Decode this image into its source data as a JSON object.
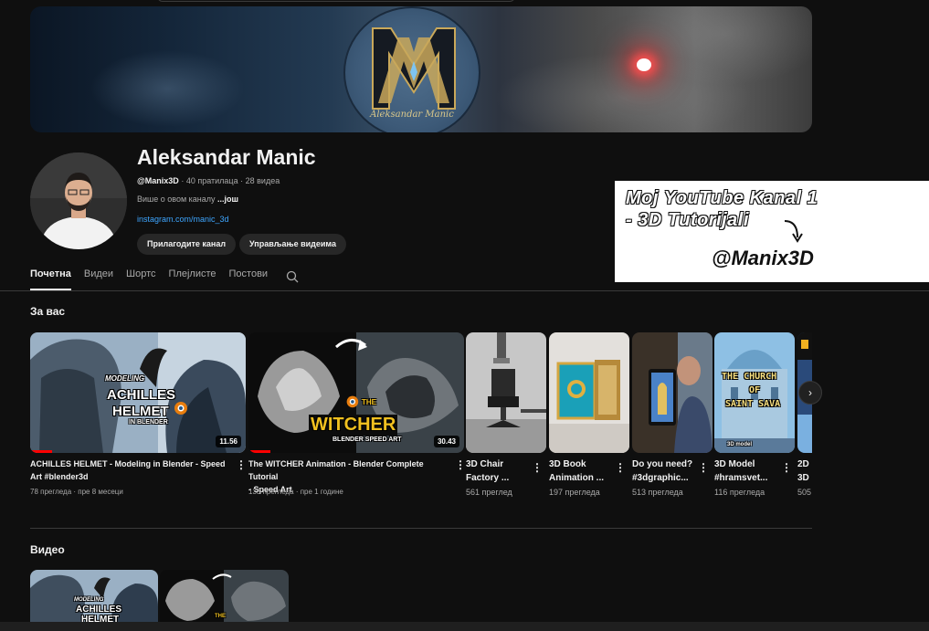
{
  "banner": {
    "logo_text": "Aleksandar Manic"
  },
  "channel": {
    "name": "Aleksandar Manic",
    "handle": "@Manix3D",
    "subscribers": "40 пратилаца",
    "videos_count": "28 видеа",
    "separator": "·",
    "about": "Више о овом каналу",
    "about_more": "...још",
    "link": "instagram.com/manic_3d",
    "customize_label": "Прилагодите канал",
    "manage_label": "Управљање видеима"
  },
  "overlay": {
    "line1": "Moj YouTube Kanal 1",
    "line2": "- 3D Tutorijali",
    "handle": "@Manix3D"
  },
  "tabs": [
    {
      "label": "Почетна",
      "active": true
    },
    {
      "label": "Видеи"
    },
    {
      "label": "Шортс"
    },
    {
      "label": "Плејлисте"
    },
    {
      "label": "Постови"
    }
  ],
  "sections": {
    "for_you": "За вас",
    "videos": "Видео"
  },
  "for_you": [
    {
      "title_l1": "ACHILLES HELMET - Modeling in Blender - Speed",
      "title_l2": "Art #blender3d",
      "views": "78 прегледа",
      "age": "пре 8 месеци",
      "duration": "11.56",
      "progress": 0.1
    },
    {
      "title_l1": "The WITCHER Animation - Blender Complete Tutorial",
      "title_l2": "- Speed Art",
      "views": "133 прегледа",
      "age": "пре 1 године",
      "duration": "30.43",
      "progress": 0.1
    },
    {
      "title_l1": "3D Chair",
      "title_l2": "Factory ...",
      "views": "561 преглед"
    },
    {
      "title_l1": "3D Book",
      "title_l2": "Animation ...",
      "views": "197 прегледа"
    },
    {
      "title_l1": "Do you need?",
      "title_l2": "#3dgraphic...",
      "views": "513 прегледа"
    },
    {
      "title_l1": "3D Model",
      "title_l2": "#hramsvet...",
      "views": "116 прегледа"
    },
    {
      "title_l1": "2D",
      "title_l2": "3D",
      "views": "505"
    }
  ],
  "thumb_text": {
    "achilles_modeling": "MODELING",
    "achilles_title1": "ACHILLES",
    "achilles_title2": "HELMET",
    "achilles_in": "IN BLENDER",
    "witcher_the": "THE",
    "witcher_title": "WITCHER",
    "witcher_sub": "BLENDER SPEED ART",
    "church_l1": "THE CHURCH",
    "church_l2": "OF",
    "church_l3": "SAINT SAVA",
    "church_bottom": "3D model",
    "small_modeling": "MODELING",
    "small_achilles": "ACHILLES",
    "small_helmet": "HELMET",
    "small_the": "THE"
  },
  "colors": {
    "accent_red": "#ff0000",
    "link_blue": "#3ea6ff",
    "background": "#0f0f0f"
  }
}
